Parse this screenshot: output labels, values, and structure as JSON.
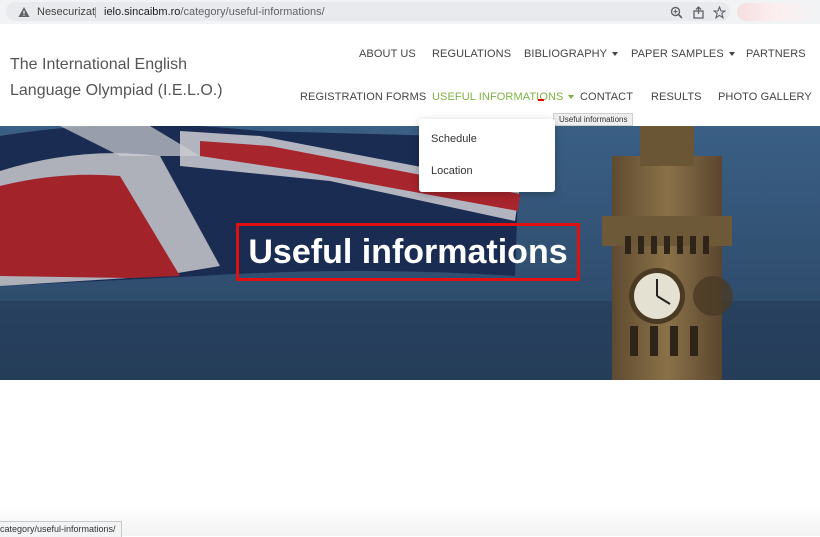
{
  "browser": {
    "security_label": "Nesecurizat",
    "url_host": "ielo.sincaibm.ro",
    "url_path": "/category/useful-informations/",
    "icons": [
      "warning-icon",
      "zoom-icon",
      "share-icon",
      "star-icon"
    ]
  },
  "site": {
    "title": "The International English Language Olympiad (I.E.L.O.)"
  },
  "nav": {
    "row1": [
      {
        "label": "ABOUT US",
        "has_dropdown": false
      },
      {
        "label": "REGULATIONS",
        "has_dropdown": false
      },
      {
        "label": "BIBLIOGRAPHY",
        "has_dropdown": true
      },
      {
        "label": "PAPER SAMPLES",
        "has_dropdown": true
      },
      {
        "label": "PARTNERS",
        "has_dropdown": false
      }
    ],
    "row2": [
      {
        "label": "REGISTRATION FORMS",
        "has_dropdown": false
      },
      {
        "label": "USEFUL INFORMATIONS",
        "has_dropdown": true,
        "active": true
      },
      {
        "label": "CONTACT",
        "has_dropdown": false
      },
      {
        "label": "RESULTS",
        "has_dropdown": false
      },
      {
        "label": "PHOTO GALLERY",
        "has_dropdown": false
      }
    ],
    "active_color": "#7cb342"
  },
  "tooltip": "Useful informations",
  "dropdown": {
    "items": [
      "Schedule",
      "Location"
    ]
  },
  "hero": {
    "title": "Useful informations",
    "highlight_color": "#e01010"
  },
  "statusbar": {
    "text": "category/useful-informations/"
  }
}
